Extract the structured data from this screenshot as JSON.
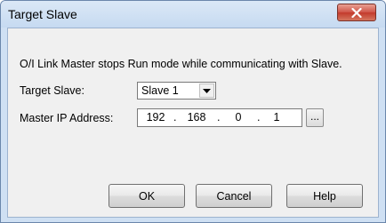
{
  "window": {
    "title": "Target Slave",
    "close_glyph": "X"
  },
  "dialog": {
    "message": "O/I Link Master stops Run mode while communicating with Slave.",
    "target_slave_label": "Target Slave:",
    "target_slave_value": "Slave 1",
    "master_ip_label": "Master IP Address:",
    "ip_octets": [
      "192",
      "168",
      "0",
      "1"
    ],
    "ip_separator": ".",
    "browse_label": "..."
  },
  "buttons": {
    "ok": "OK",
    "cancel": "Cancel",
    "help": "Help"
  },
  "icons": {
    "close": "close-icon",
    "dropdown": "chevron-down-icon"
  }
}
